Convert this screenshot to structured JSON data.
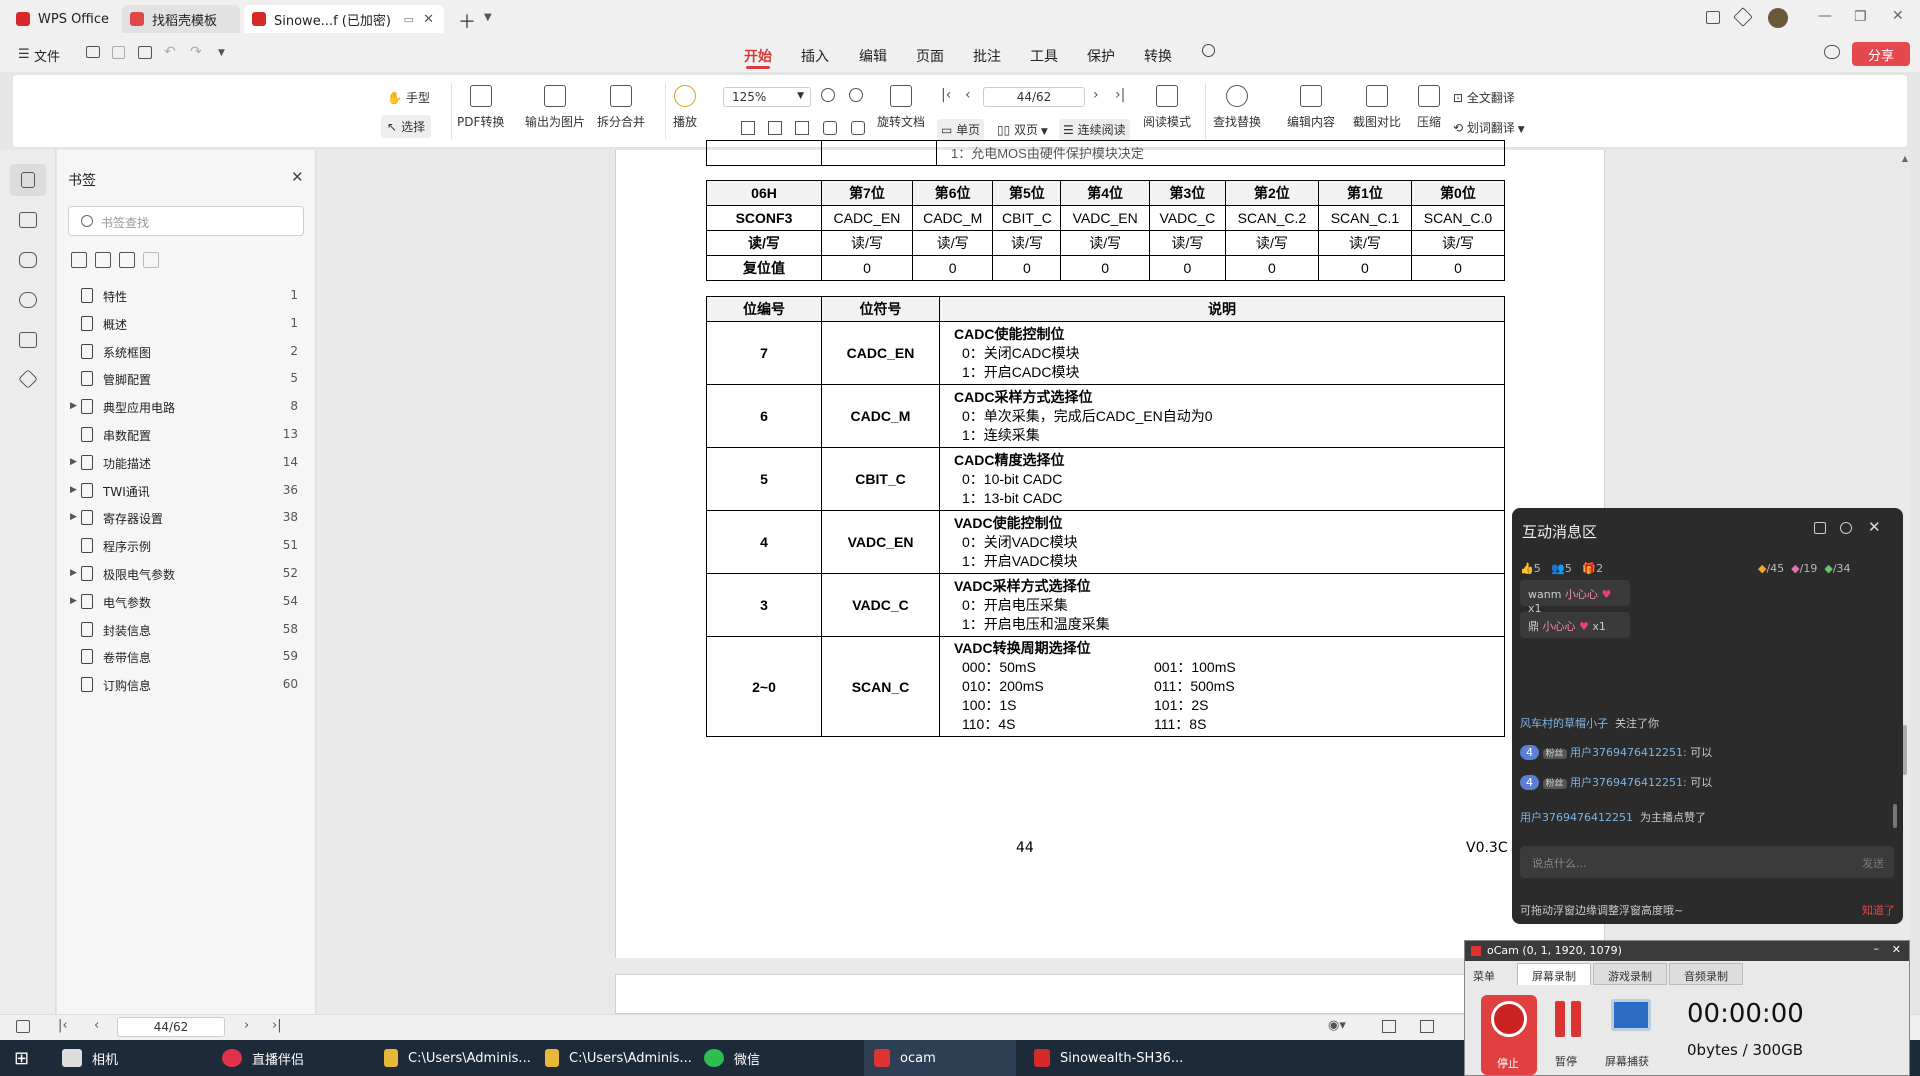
{
  "tabs": [
    {
      "label": "WPS Office"
    },
    {
      "label": "找稻壳模板"
    },
    {
      "label": "Sinowe...f (已加密)"
    }
  ],
  "menu": {
    "file": "文件",
    "items": [
      "开始",
      "插入",
      "编辑",
      "页面",
      "批注",
      "工具",
      "保护",
      "转换"
    ],
    "share": "分享"
  },
  "ribbon": {
    "hand": "手型",
    "select": "选择",
    "pdf_convert": "PDF转换",
    "export_img": "输出为图片",
    "split_merge": "拆分合并",
    "play": "播放",
    "zoom": "125%",
    "page": "44/62",
    "rotate": "旋转文档",
    "single": "单页",
    "double": "双页",
    "continuous": "连续阅读",
    "read_mode": "阅读模式",
    "find_replace": "查找替换",
    "edit_content": "编辑内容",
    "screenshot_compare": "截图对比",
    "compress": "压缩",
    "full_translate": "全文翻译",
    "word_translate": "划词翻译"
  },
  "bookmarks": {
    "title": "书签",
    "search_placeholder": "书签查找",
    "items": [
      {
        "label": "特性",
        "page": "1",
        "expand": false
      },
      {
        "label": "概述",
        "page": "1",
        "expand": false
      },
      {
        "label": "系统框图",
        "page": "2",
        "expand": false
      },
      {
        "label": "管脚配置",
        "page": "5",
        "expand": false
      },
      {
        "label": "典型应用电路",
        "page": "8",
        "expand": true
      },
      {
        "label": "串数配置",
        "page": "13",
        "expand": false
      },
      {
        "label": "功能描述",
        "page": "14",
        "expand": true
      },
      {
        "label": "TWI通讯",
        "page": "36",
        "expand": true
      },
      {
        "label": "寄存器设置",
        "page": "38",
        "expand": true
      },
      {
        "label": "程序示例",
        "page": "51",
        "expand": false
      },
      {
        "label": "极限电气参数",
        "page": "52",
        "expand": true
      },
      {
        "label": "电气参数",
        "page": "54",
        "expand": true
      },
      {
        "label": "封装信息",
        "page": "58",
        "expand": false
      },
      {
        "label": "卷带信息",
        "page": "59",
        "expand": false
      },
      {
        "label": "订购信息",
        "page": "60",
        "expand": false
      }
    ]
  },
  "doc": {
    "top_fragment": "1：允电MOS由硬件保护模块决定",
    "reg": {
      "header": [
        "06H",
        "第7位",
        "第6位",
        "第5位",
        "第4位",
        "第3位",
        "第2位",
        "第1位",
        "第0位"
      ],
      "name_row": [
        "SCONF3",
        "CADC_EN",
        "CADC_M",
        "CBIT_C",
        "VADC_EN",
        "VADC_C",
        "SCAN_C.2",
        "SCAN_C.1",
        "SCAN_C.0"
      ],
      "rw_row": [
        "读/写",
        "读/写",
        "读/写",
        "读/写",
        "读/写",
        "读/写",
        "读/写",
        "读/写",
        "读/写"
      ],
      "reset_row": [
        "复位值",
        "0",
        "0",
        "0",
        "0",
        "0",
        "0",
        "0",
        "0"
      ]
    },
    "desc_header": [
      "位编号",
      "位符号",
      "说明"
    ],
    "desc_rows": [
      {
        "bit": "7",
        "sym": "CADC_EN",
        "title": "CADC使能控制位",
        "lines": [
          "0：关闭CADC模块",
          "1：开启CADC模块"
        ]
      },
      {
        "bit": "6",
        "sym": "CADC_M",
        "title": "CADC采样方式选择位",
        "lines": [
          "0：单次采集，完成后CADC_EN自动为0",
          "1：连续采集"
        ]
      },
      {
        "bit": "5",
        "sym": "CBIT_C",
        "title": "CADC精度选择位",
        "lines": [
          "0：10-bit CADC",
          "1：13-bit CADC"
        ]
      },
      {
        "bit": "4",
        "sym": "VADC_EN",
        "title": "VADC使能控制位",
        "lines": [
          "0：关闭VADC模块",
          "1：开启VADC模块"
        ]
      },
      {
        "bit": "3",
        "sym": "VADC_C",
        "title": "VADC采样方式选择位",
        "lines": [
          "0：开启电压采集",
          "1：开启电压和温度采集"
        ]
      }
    ],
    "scan": {
      "bit": "2~0",
      "sym": "SCAN_C",
      "title": "VADC转换周期选择位",
      "left": [
        "000：50mS",
        "010：200mS",
        "100：1S",
        "110：4S"
      ],
      "right": [
        "001：100mS",
        "011：500mS",
        "101：2S",
        "111：8S"
      ]
    },
    "page_num": "44",
    "version": "V0.3C"
  },
  "status": {
    "page": "44/62"
  },
  "messages": {
    "title": "互动消息区",
    "stats_left": [
      "5",
      "5",
      "2"
    ],
    "stats_right": [
      "/45",
      "/19",
      "/34"
    ],
    "gifts": [
      {
        "user": "wanm",
        "text": "小心心",
        "count": "x1"
      },
      {
        "user": "鼎",
        "text": "小心心",
        "count": "x1"
      }
    ],
    "follow_user": "风车村的草帽小子",
    "follow_text": "关注了你",
    "chats": [
      {
        "level": "4",
        "badge": "粉丝",
        "user": "用户3769476412251:",
        "text": "可以"
      },
      {
        "level": "4",
        "badge": "粉丝",
        "user": "用户3769476412251:",
        "text": "可以"
      }
    ],
    "like_user": "用户3769476412251",
    "like_text": "为主播点赞了",
    "input_placeholder": "说点什么...",
    "send": "发送",
    "tip": "可拖动浮窗边缘调整浮窗高度哦~",
    "tip_link": "知道了"
  },
  "ocam": {
    "title": "oCam (0, 1, 1920, 1079)",
    "tabs": [
      "菜单",
      "屏幕录制",
      "游戏录制",
      "音频录制"
    ],
    "stop": "停止",
    "pause": "暂停",
    "capture": "屏幕捕获",
    "time": "00:00:00",
    "size": "0bytes / 300GB"
  },
  "taskbar": [
    {
      "label": "相机"
    },
    {
      "label": "直播伴侣"
    },
    {
      "label": "C:\\Users\\Adminis..."
    },
    {
      "label": "C:\\Users\\Adminis..."
    },
    {
      "label": "微信"
    },
    {
      "label": "ocam"
    },
    {
      "label": "Sinowealth-SH36..."
    }
  ]
}
